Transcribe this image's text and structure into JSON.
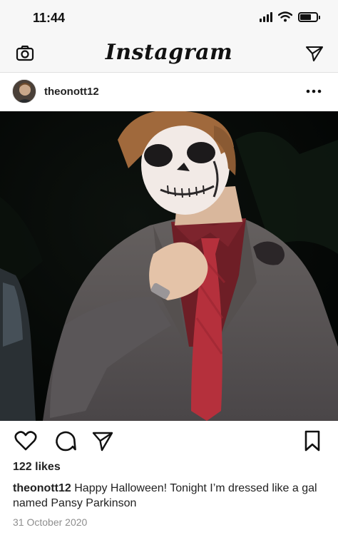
{
  "status_bar": {
    "time": "11:44",
    "battery_level": 0.7
  },
  "nav": {
    "logo": "Instagram",
    "left_icon": "camera-icon",
    "right_icon": "paper-plane-icon"
  },
  "post": {
    "username": "theonott12",
    "more_icon": "more-dots-icon",
    "image_subject": "person in skull face paint, grey suit, red tie",
    "likes": "122 likes",
    "caption_user": "theonott12",
    "caption_text": "Happy Halloween! Tonight I’m dressed like a gal named Pansy Parkinson",
    "date": "31 October 2020"
  },
  "actions": {
    "like_icon": "heart-icon",
    "comment_icon": "comment-bubble-icon",
    "share_icon": "paper-plane-icon",
    "save_icon": "bookmark-icon"
  },
  "colors": {
    "bar_bg": "#f7f7f7",
    "text": "#222222",
    "muted": "#8e8e8e",
    "tie": "#b5303c",
    "shirt": "#6e1e26",
    "suit": "#5a5658"
  }
}
